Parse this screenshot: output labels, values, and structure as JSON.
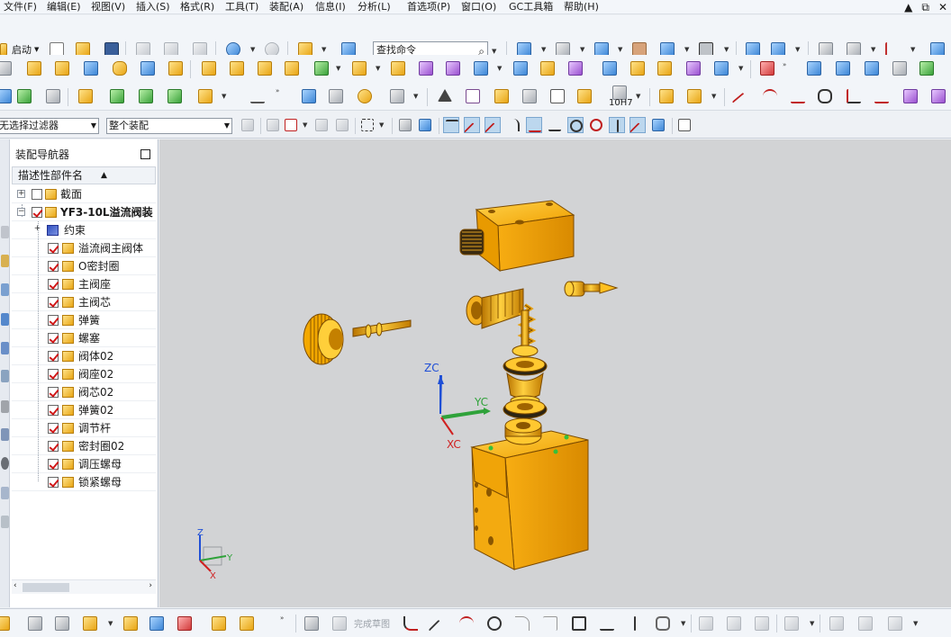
{
  "menu": [
    "文件(F)",
    "编辑(E)",
    "视图(V)",
    "插入(S)",
    "格式(R)",
    "工具(T)",
    "装配(A)",
    "信息(I)",
    "分析(L)",
    "首选项(P)",
    "窗口(O)",
    "GC工具箱",
    "帮助(H)"
  ],
  "window_controls": [
    "▲",
    "⧉",
    "✕"
  ],
  "toolbar": {
    "start_label": "启动",
    "search_placeholder": "查找命令",
    "selection_filter": "无选择过滤器",
    "assembly_scope": "整个装配",
    "tolerance_label": "10H7",
    "finish_sketch": "完成草图"
  },
  "navigator": {
    "title": "装配导航器",
    "column_header": "描述性部件名",
    "sort_glyph": "▲",
    "nodes": [
      {
        "label": "截面",
        "toggle": "+",
        "checked": false,
        "icon": "folder"
      },
      {
        "label": "YF3-10L溢流阀装",
        "toggle": "−",
        "checked": true,
        "icon": "assembly"
      },
      {
        "label": "约束",
        "toggle": "+",
        "checked": null,
        "icon": "constraints"
      },
      {
        "label": "溢流阀主阀体",
        "checked": true,
        "icon": "part"
      },
      {
        "label": "O密封圈",
        "checked": true,
        "icon": "part"
      },
      {
        "label": "主阀座",
        "checked": true,
        "icon": "part"
      },
      {
        "label": "主阀芯",
        "checked": true,
        "icon": "part"
      },
      {
        "label": "弹簧",
        "checked": true,
        "icon": "part"
      },
      {
        "label": "螺塞",
        "checked": true,
        "icon": "part"
      },
      {
        "label": "阀体02",
        "checked": true,
        "icon": "part"
      },
      {
        "label": "阀座02",
        "checked": true,
        "icon": "part"
      },
      {
        "label": "阀芯02",
        "checked": true,
        "icon": "part"
      },
      {
        "label": "弹簧02",
        "checked": true,
        "icon": "part"
      },
      {
        "label": "调节杆",
        "checked": true,
        "icon": "part"
      },
      {
        "label": "密封圈02",
        "checked": true,
        "icon": "part"
      },
      {
        "label": "调压螺母",
        "checked": true,
        "icon": "part"
      },
      {
        "label": "锁紧螺母",
        "checked": true,
        "icon": "part"
      }
    ]
  },
  "viewport": {
    "background": "#d2d3d5",
    "part_color": "#f5a800",
    "csys_labels": {
      "zc": "ZC",
      "yc": "YC",
      "xc": "XC"
    },
    "triad_labels": {
      "z": "Z",
      "y": "Y",
      "x": "X"
    }
  }
}
